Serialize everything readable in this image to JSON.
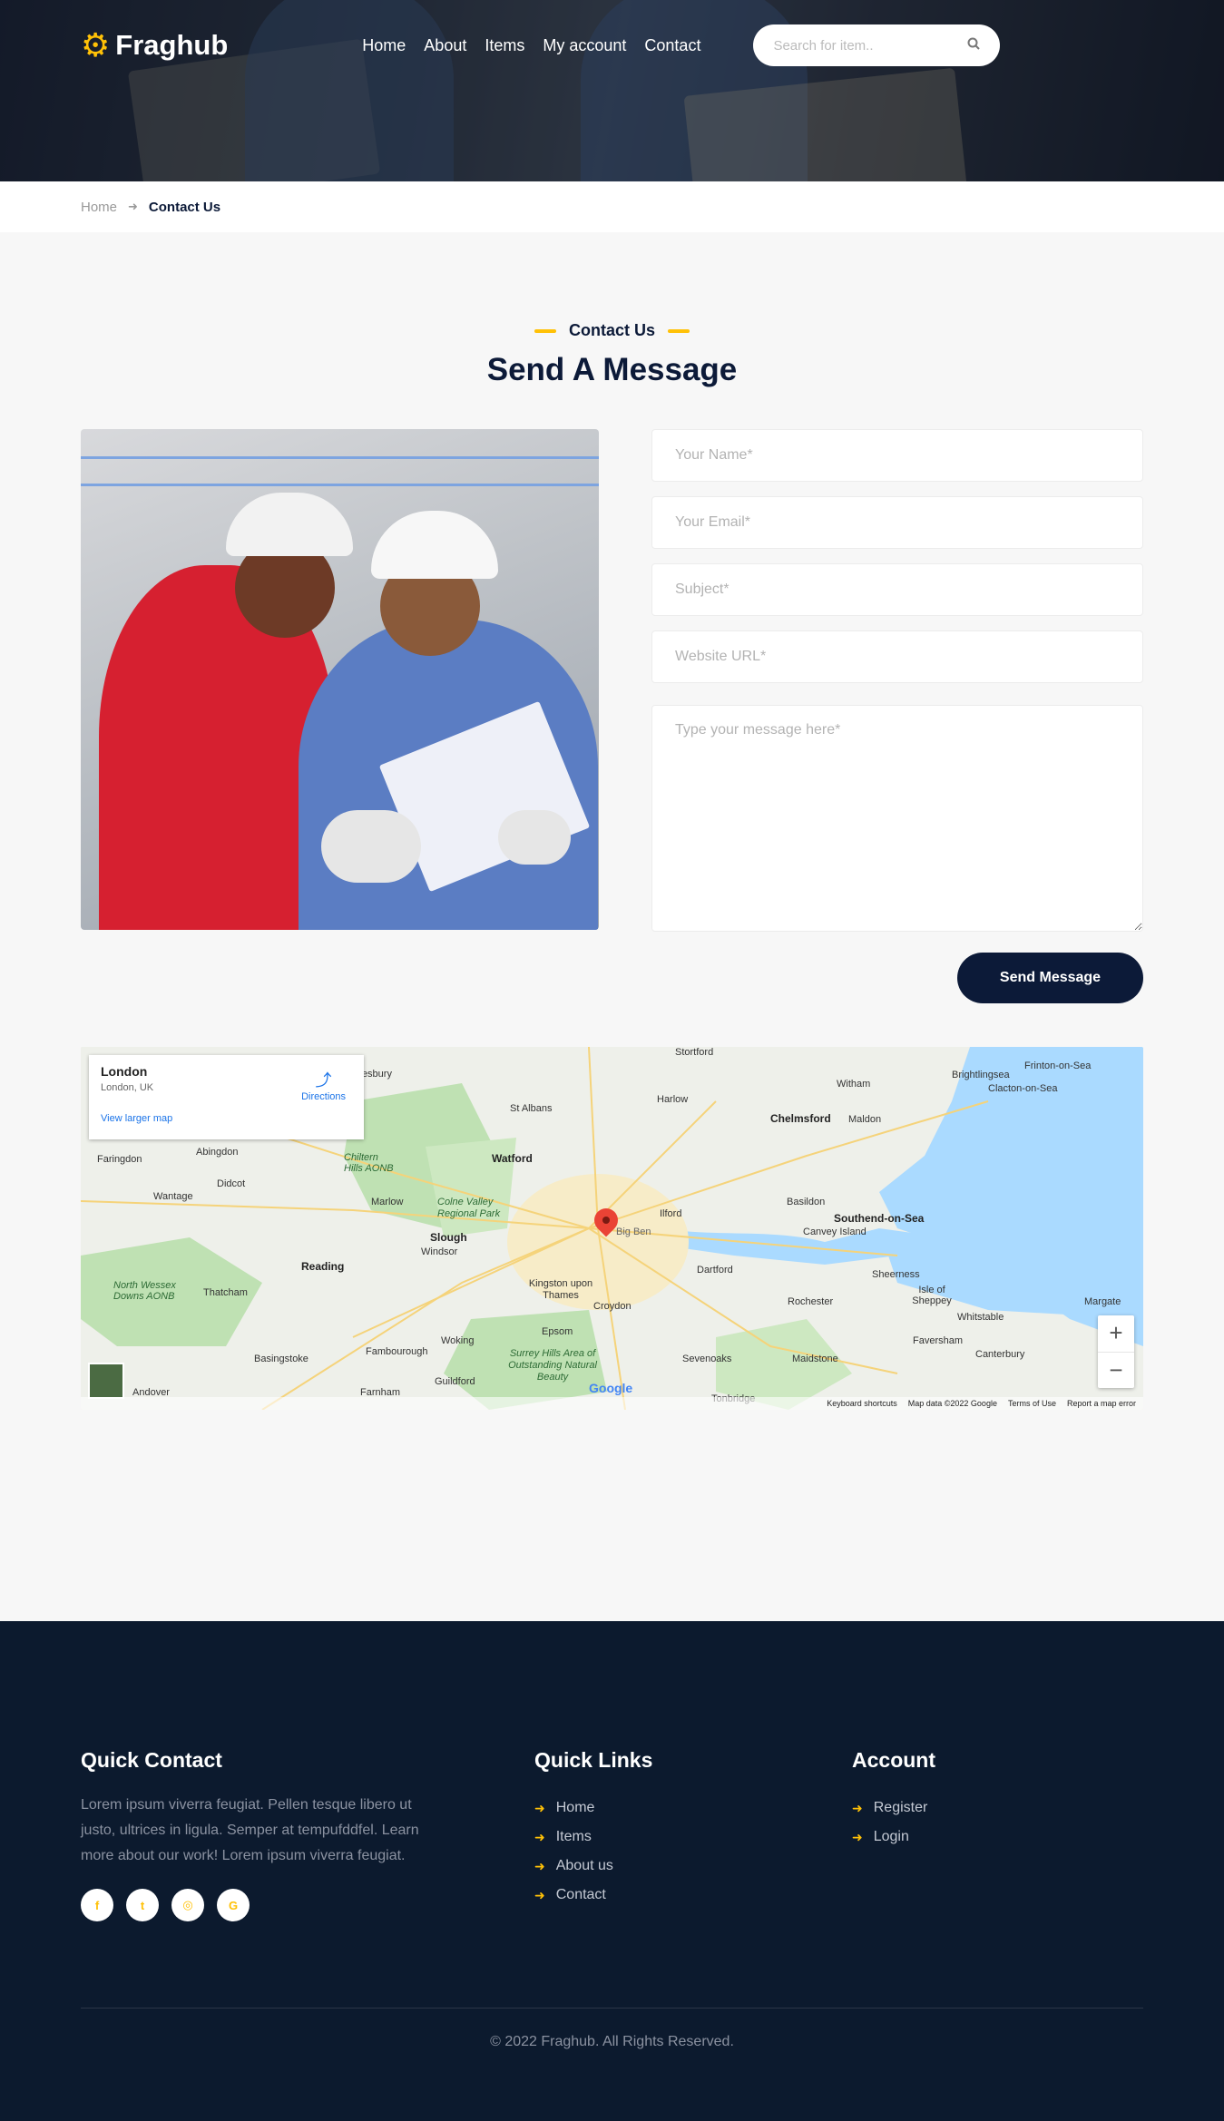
{
  "brand": {
    "name": "Fraghub",
    "accent": "#ffc107",
    "navy": "#0c1a38"
  },
  "nav": {
    "items": [
      "Home",
      "About",
      "Items",
      "My account",
      "Contact"
    ]
  },
  "search": {
    "placeholder": "Search for item..",
    "icon": "search-icon"
  },
  "breadcrumb": {
    "home": "Home",
    "current": "Contact Us"
  },
  "contact": {
    "label": "Contact Us",
    "title": "Send A Message",
    "form": {
      "name_placeholder": "Your Name*",
      "email_placeholder": "Your Email*",
      "subject_placeholder": "Subject*",
      "website_placeholder": "Website URL*",
      "message_placeholder": "Type your message here*",
      "submit_label": "Send Message"
    }
  },
  "map": {
    "place": "London",
    "place_sub": "London, UK",
    "directions": "Directions",
    "view_larger": "View larger map",
    "pin_label": "Big Ben",
    "google": "Google",
    "zoom_in": "+",
    "zoom_out": "−",
    "footer_links": [
      "Keyboard shortcuts",
      "Map data ©2022 Google",
      "Terms of Use",
      "Report a map error"
    ],
    "labels": [
      "Stortford",
      "Harlow",
      "Witham",
      "Brightlingsea",
      "Frinton-on-Sea",
      "Clacton-on-Sea",
      "Chelmsford",
      "Maldon",
      "St Albans",
      "Watford",
      "Abingdon",
      "Faringdon",
      "Chiltern Hills AONB",
      "Didcot",
      "Wantage",
      "Marlow",
      "Colne Valley Regional Park",
      "Slough",
      "Windsor",
      "Ilford",
      "Basildon",
      "Southend-on-Sea",
      "Canvey Island",
      "Reading",
      "Kingston upon Thames",
      "Croydon",
      "Dartford",
      "Sheerness",
      "Isle of Sheppey",
      "Margate",
      "North Wessex Downs AONB",
      "Thatcham",
      "Rochester",
      "Whitstable",
      "Faversham",
      "Woking",
      "Epsom",
      "Sevenoaks",
      "Maidstone",
      "Canterbury",
      "Fambourough",
      "Basingstoke",
      "Surrey Hills Area of Outstanding Natural Beauty",
      "Guildford",
      "Farnham",
      "Andover",
      "Tonbridge",
      "ylesbury"
    ]
  },
  "footer": {
    "quick_contact": {
      "title": "Quick Contact",
      "text": "Lorem ipsum viverra feugiat. Pellen tesque libero ut justo, ultrices in ligula. Semper at tempufddfel. Learn more about our work! Lorem ipsum viverra feugiat.",
      "socials": [
        "f",
        "t",
        "◎",
        "G"
      ]
    },
    "quick_links": {
      "title": "Quick Links",
      "items": [
        "Home",
        "Items",
        "About us",
        "Contact"
      ]
    },
    "account": {
      "title": "Account",
      "items": [
        "Register",
        "Login"
      ]
    },
    "copyright": "© 2022 Fraghub. All Rights Reserved."
  }
}
